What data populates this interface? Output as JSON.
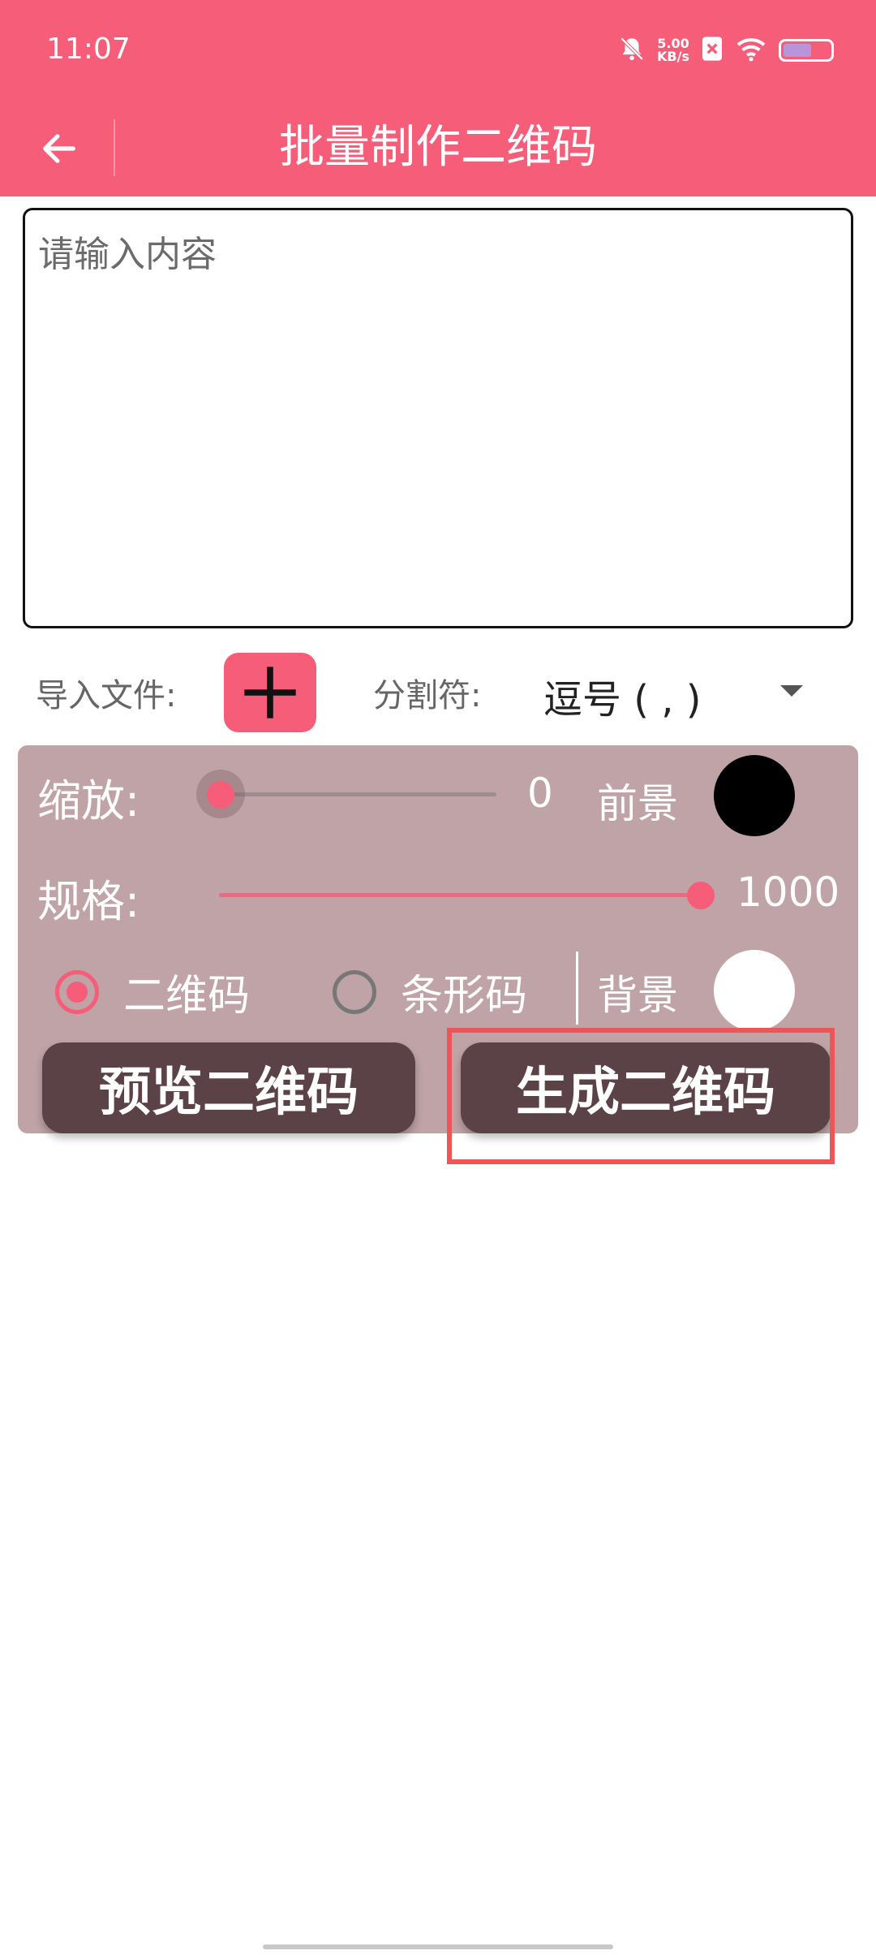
{
  "status_bar": {
    "time": "11:07",
    "net_speed_value": "5.00",
    "net_speed_unit": "KB/s"
  },
  "app_bar": {
    "title": "批量制作二维码"
  },
  "input": {
    "placeholder": "请输入内容",
    "value": ""
  },
  "import": {
    "label": "导入文件:",
    "separator_label": "分割符:",
    "separator_value": "逗号 ( , )"
  },
  "settings": {
    "zoom_label": "缩放:",
    "zoom_value": "0",
    "zoom_fraction": 0,
    "foreground_label": "前景",
    "foreground_color": "#000000",
    "size_label": "规格:",
    "size_value": "1000",
    "size_fraction": 1,
    "type_options": [
      "二维码",
      "条形码"
    ],
    "type_selected": "二维码",
    "background_label": "背景",
    "background_color": "#ffffff"
  },
  "buttons": {
    "preview": "预览二维码",
    "generate": "生成二维码"
  },
  "colors": {
    "accent": "#F55D78",
    "panel": "#BFA3A6",
    "button_dark": "#5A4246",
    "highlight": "#EE5556"
  }
}
